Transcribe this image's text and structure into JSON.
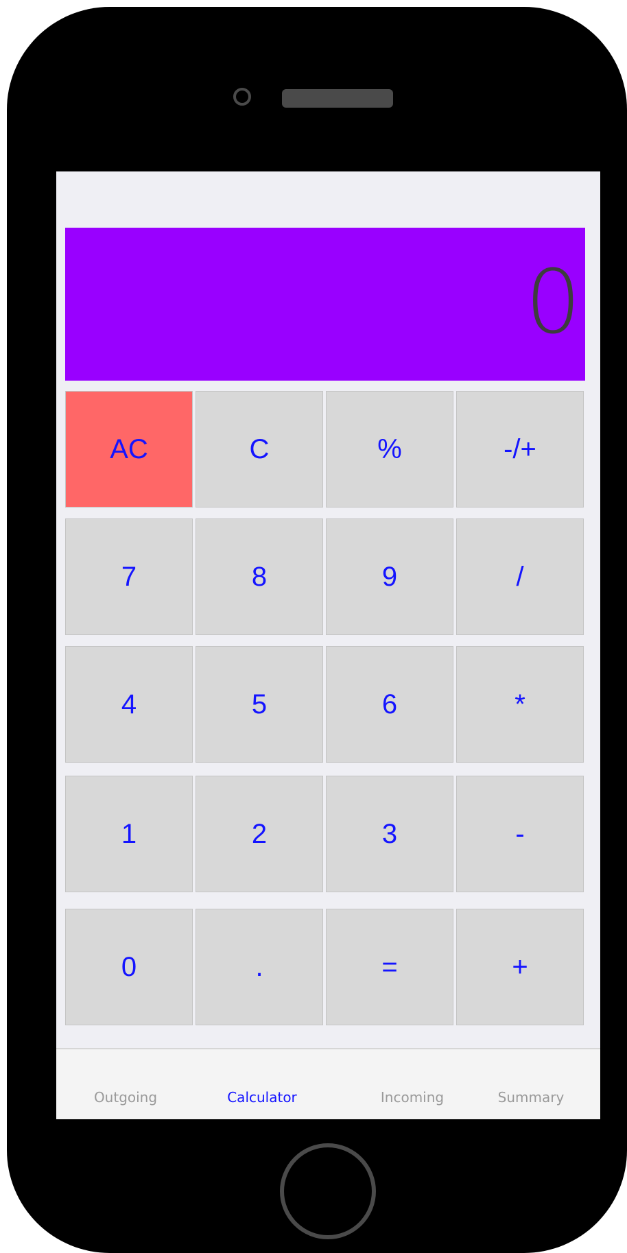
{
  "display": {
    "value": "0"
  },
  "keypad": {
    "rows": [
      [
        "AC",
        "C",
        "%",
        "-/+"
      ],
      [
        "7",
        "8",
        "9",
        "/"
      ],
      [
        "4",
        "5",
        "6",
        "*"
      ],
      [
        "1",
        "2",
        "3",
        "-"
      ],
      [
        "0",
        ".",
        "=",
        "+"
      ]
    ]
  },
  "tabs": [
    {
      "label": "Outgoing",
      "active": false
    },
    {
      "label": "Calculator",
      "active": true
    },
    {
      "label": "Incoming",
      "active": false
    },
    {
      "label": "Summary",
      "active": false
    }
  ],
  "colors": {
    "display_background": "#9900ff",
    "display_text": "#3d3d3d",
    "key_background": "#d8d8d8",
    "clear_key_background": "#ff6767",
    "key_text": "#1414ff",
    "active_tab": "#1414ff",
    "inactive_tab": "#9a9a9a"
  }
}
